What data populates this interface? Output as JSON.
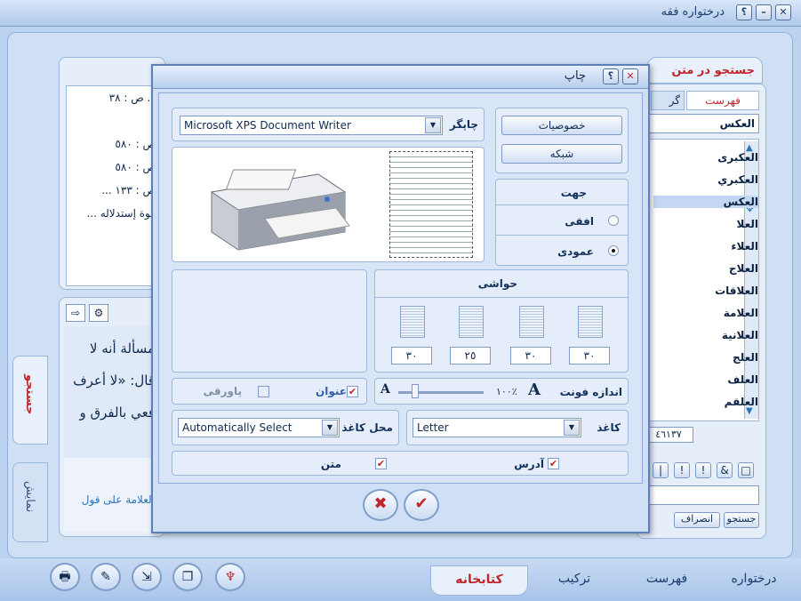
{
  "window": {
    "title": "درختواره فقه",
    "close": "✕",
    "minimize": "–",
    "help": "؟"
  },
  "left_pane": {
    "header_line": "... ص : ٣٨",
    "results": [
      "ص : ٥٨٠",
      "ص : ٥٨٠",
      "ص : ١٣٣ ...",
      "فوة إستدلاله ..."
    ],
    "text_lines": [
      "مسألة أنه لا",
      "قال: «لا أعرف",
      "فعي بالفرق و"
    ],
    "footer_text": "العلامة على قول",
    "toolbar_arrow": "⇨",
    "toolbar_tool": "⚙"
  },
  "side_tabs": {
    "search": "جستجو",
    "notes": "نمايش"
  },
  "right_panel": {
    "tab_title": "جستجو در متن",
    "subtab_index": "فهرست",
    "subtab_other": "گر",
    "search_value": "العكس",
    "items": [
      "العكبرى",
      "العكبري",
      "العكس",
      "العلا",
      "العلاء",
      "العلاج",
      "العلاقات",
      "العلامة",
      "العلانية",
      "العلج",
      "العلف",
      "العلقم"
    ],
    "selected_index": 2,
    "count": "٤٦١٣٧",
    "search_button": "جستجو",
    "cancel_button": "انصراف",
    "symbols": [
      "□",
      "&",
      "!",
      "!",
      "|"
    ]
  },
  "bottom_tabs": {
    "library": "كتابخانه",
    "compose": "تركيب",
    "index": "فهرست",
    "tree": "درختواره"
  },
  "toolbar_icons": [
    "printer-icon",
    "edit-icon",
    "export-icon",
    "copy-icon",
    "tree-icon"
  ],
  "dialog": {
    "title": "چاپ",
    "printer_label": "چاپگر",
    "printer_value": "Microsoft XPS Document Writer",
    "properties_button": "خصوصيات",
    "network_button": "شبكه",
    "orientation_label": "جهت",
    "landscape_label": "افقى",
    "portrait_label": "عمودى",
    "orientation_selected": "portrait",
    "margins_label": "حواشى",
    "margins": [
      "٣٠",
      "٢٥",
      "٣٠",
      "٣٠"
    ],
    "font_size_label": "اندازه فونت",
    "font_percent": "١٠٠٪",
    "font_small": "A",
    "font_big": "A",
    "font_slider_level": 0.2,
    "title_label": "عنوان",
    "title_checked": true,
    "footnote_label": "پاورقى",
    "footnote_checked": false,
    "paper_label": "كاغذ",
    "paper_value": "Letter",
    "paper_source_label": "محل كاغذ",
    "paper_source_value": "Automatically Select",
    "address_label": "آدرس",
    "address_checked": true,
    "text_label": "متن",
    "text_checked": true,
    "ok": "✔",
    "cancel": "✖"
  }
}
